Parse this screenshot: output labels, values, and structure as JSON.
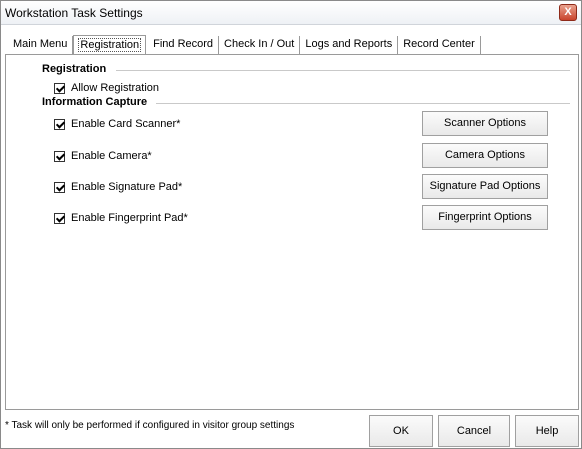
{
  "window": {
    "title": "Workstation Task Settings",
    "close_label": "X"
  },
  "tabs": [
    {
      "label": "Main Menu"
    },
    {
      "label": "Registration"
    },
    {
      "label": "Find Record"
    },
    {
      "label": "Check In / Out"
    },
    {
      "label": "Logs and Reports"
    },
    {
      "label": "Record Center"
    }
  ],
  "registration": {
    "title": "Registration",
    "allow_label": "Allow Registration",
    "allow_checked": true
  },
  "capture": {
    "title": "Information Capture",
    "items": [
      {
        "label": "Enable Card Scanner*",
        "checked": true,
        "button": "Scanner Options"
      },
      {
        "label": "Enable Camera*",
        "checked": true,
        "button": "Camera Options"
      },
      {
        "label": "Enable Signature Pad*",
        "checked": true,
        "button": "Signature Pad Options"
      },
      {
        "label": "Enable Fingerprint Pad*",
        "checked": true,
        "button": "Fingerprint Options"
      }
    ]
  },
  "footer": {
    "note": "* Task will only be performed if configured in visitor group settings",
    "ok": "OK",
    "cancel": "Cancel",
    "help": "Help"
  },
  "colors": {
    "close_button": "#c9432b",
    "border": "#9a9a9a"
  }
}
